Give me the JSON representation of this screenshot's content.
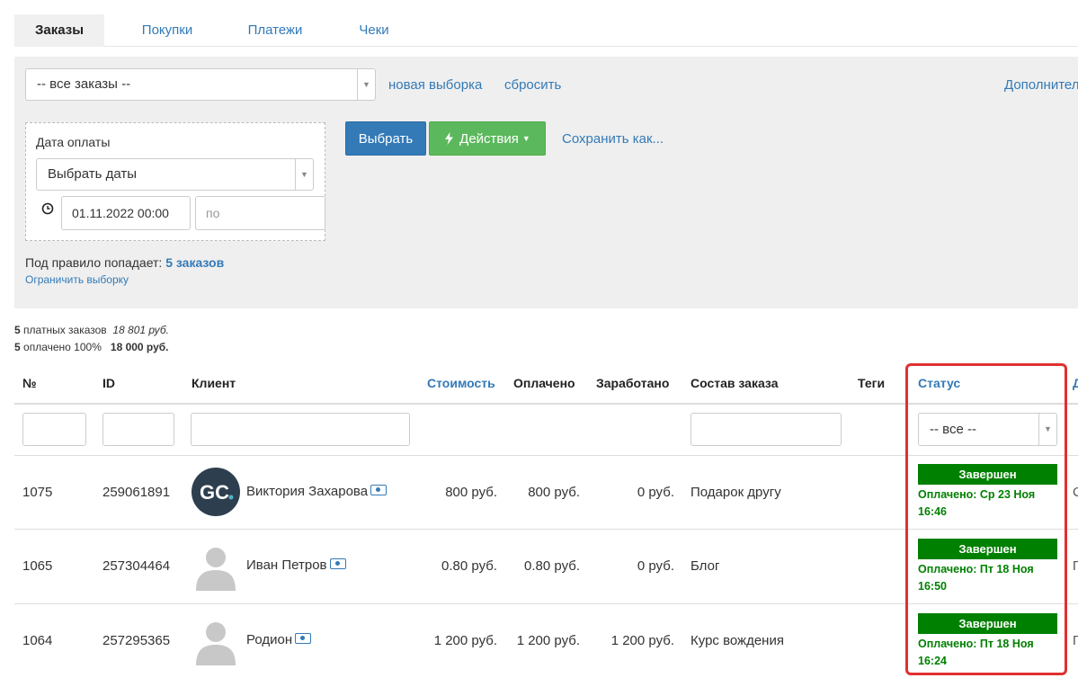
{
  "tabs": [
    "Заказы",
    "Покупки",
    "Платежи",
    "Чеки"
  ],
  "filter": {
    "selection_value": "-- все заказы --",
    "new_selection_link": "новая выборка",
    "reset_link": "сбросить",
    "additional_link": "Дополнител",
    "date_label": "Дата оплаты",
    "date_select_value": "Выбрать даты",
    "date_from": "01.11.2022 00:00",
    "date_to_placeholder": "по",
    "select_button": "Выбрать",
    "actions_button": "Действия",
    "save_as_link": "Сохранить как...",
    "rule_text": "Под правило попадает:",
    "rule_count": "5 заказов",
    "limit_link": "Ограничить выборку"
  },
  "summary": {
    "paid_count": "5",
    "paid_label": "платных заказов",
    "paid_sum": "18 801 руб.",
    "full_count": "5",
    "full_label": "оплачено 100%",
    "full_sum": "18 000 руб."
  },
  "table": {
    "headers": {
      "num": "№",
      "id": "ID",
      "client": "Клиент",
      "cost": "Стоимость",
      "paid": "Оплачено",
      "earned": "Заработано",
      "composition": "Состав заказа",
      "tags": "Теги",
      "status": "Статус",
      "next": "Д"
    },
    "status_filter_value": "-- все --",
    "rows": [
      {
        "num": "1075",
        "id": "259061891",
        "client": "Виктория Захарова",
        "cost": "800 руб.",
        "paid": "800 руб.",
        "earned": "0 руб.",
        "composition": "Подарок другу",
        "status": "Завершен",
        "status_detail_1": "Оплачено: Ср 23 Ноя",
        "status_detail_2": "16:46",
        "edge": "С",
        "avatar": "gc-logo"
      },
      {
        "num": "1065",
        "id": "257304464",
        "client": "Иван Петров",
        "cost": "0.80 руб.",
        "paid": "0.80 руб.",
        "earned": "0 руб.",
        "composition": "Блог",
        "status": "Завершен",
        "status_detail_1": "Оплачено: Пт 18 Ноя",
        "status_detail_2": "16:50",
        "edge": "П",
        "avatar": "user-silhouette"
      },
      {
        "num": "1064",
        "id": "257295365",
        "client": "Родион",
        "cost": "1 200 руб.",
        "paid": "1 200 руб.",
        "earned": "1 200 руб.",
        "composition": "Курс вождения",
        "status": "Завершен",
        "status_detail_1": "Оплачено: Пт 18 Ноя",
        "status_detail_2": "16:24",
        "edge": "П",
        "avatar": "user-silhouette"
      }
    ]
  },
  "colors": {
    "link": "#337ab7",
    "status_green": "#008000",
    "highlight_red": "#e03030",
    "button_green": "#5cb85c",
    "button_blue": "#337ab7"
  }
}
